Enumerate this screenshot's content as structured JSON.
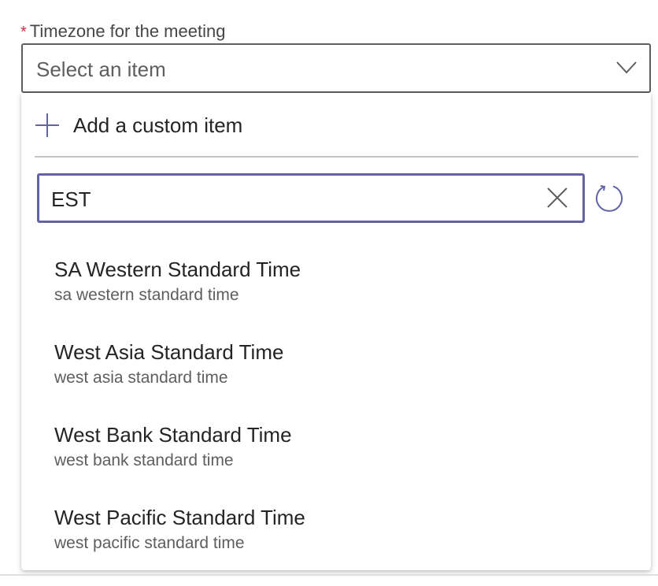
{
  "field": {
    "required_mark": "*",
    "label": "Timezone for the meeting",
    "placeholder": "Select an item"
  },
  "dropdown": {
    "add_custom_label": "Add a custom item",
    "search_value": "EST",
    "options": [
      {
        "title": "SA Western Standard Time",
        "subtitle": "sa western standard time"
      },
      {
        "title": "West Asia Standard Time",
        "subtitle": "west asia standard time"
      },
      {
        "title": "West Bank Standard Time",
        "subtitle": "west bank standard time"
      },
      {
        "title": "West Pacific Standard Time",
        "subtitle": "west pacific standard time"
      }
    ]
  },
  "icons": {
    "chevron": "chevron-down-icon",
    "add": "plus-icon",
    "clear": "close-icon",
    "refresh": "refresh-icon"
  },
  "colors": {
    "accent": "#6264a7",
    "required": "#c4314b",
    "text": "#252423",
    "secondary_text": "#605e5c"
  }
}
